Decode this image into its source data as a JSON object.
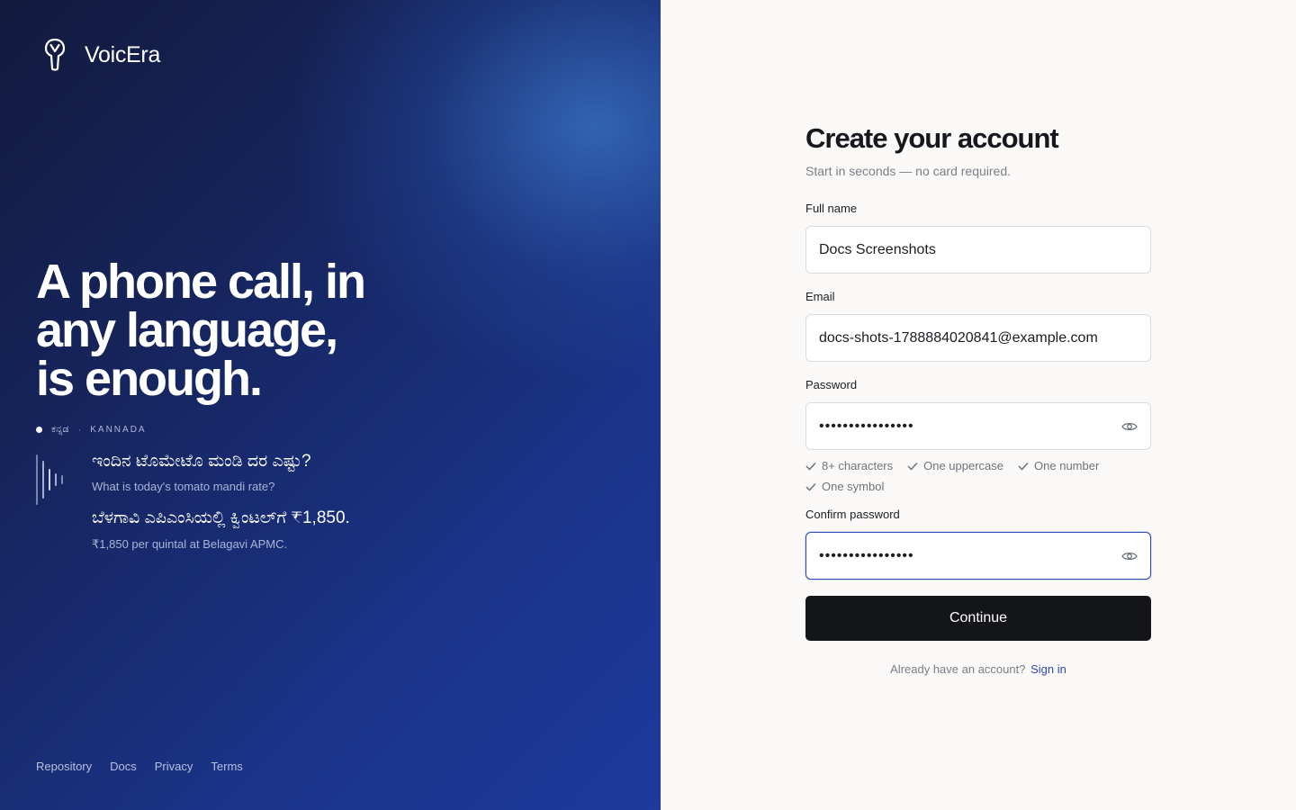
{
  "brand": {
    "name": "VoicEra"
  },
  "hero": {
    "headline": [
      "A phone call, in",
      "any language,",
      "is enough."
    ],
    "language": {
      "native": "ಕನ್ನಡ",
      "separator": "·",
      "code": "KANNADA"
    },
    "question": {
      "native": "ಇಂದಿನ ಟೊಮೇಟೊ ಮಂಡಿ ದರ ಎಷ್ಟು?",
      "translation": "What is today's tomato mandi rate?"
    },
    "answer": {
      "native": "ಬೆಳಗಾವಿ ಎಪಿಎಂಸಿಯಲ್ಲಿ ಕ್ವಿಂಟಲ್‌ಗೆ ₹1,850.",
      "translation": "₹1,850 per quintal at Belagavi APMC."
    }
  },
  "footer": {
    "links": [
      "Repository",
      "Docs",
      "Privacy",
      "Terms"
    ]
  },
  "form": {
    "title": "Create your account",
    "subtitle": "Start in seconds — no card required.",
    "full_name": {
      "label": "Full name",
      "value": "Docs Screenshots"
    },
    "email": {
      "label": "Email",
      "value": "docs-shots-1788884020841@example.com"
    },
    "password": {
      "label": "Password",
      "value": "••••••••••••••••"
    },
    "requirements": [
      "8+ characters",
      "One uppercase",
      "One number",
      "One symbol"
    ],
    "confirm_password": {
      "label": "Confirm password",
      "value": "••••••••••••••••"
    },
    "submit_label": "Continue",
    "signin_prompt": "Already have an account?",
    "signin_link": "Sign in"
  },
  "colors": {
    "accent": "#2d49b5",
    "button": "#141518",
    "panel_dark": "#16255e",
    "background": "#faf9f7"
  }
}
